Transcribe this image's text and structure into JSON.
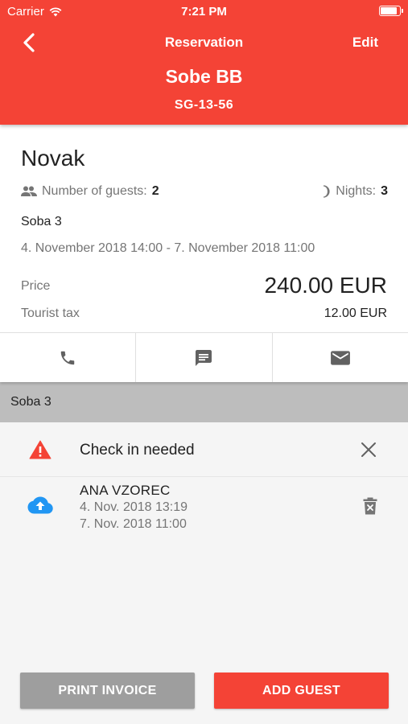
{
  "status_bar": {
    "carrier": "Carrier",
    "time": "7:21 PM",
    "battery_level": 0.92
  },
  "nav": {
    "title": "Reservation",
    "edit_label": "Edit",
    "back_icon": "chevron-left-icon"
  },
  "property": {
    "name": "Sobe BB",
    "code": "SG-13-56"
  },
  "reservation": {
    "guest_name": "Novak",
    "guests_label": "Number of guests:",
    "guests_value": "2",
    "nights_label": "Nights:",
    "nights_value": "3",
    "room": "Soba 3",
    "dates": "4. November 2018 14:00 - 7. November 2018 11:00",
    "price_label": "Price",
    "price_value": "240.00 EUR",
    "tax_label": "Tourist tax",
    "tax_value": "12.00 EUR"
  },
  "actions": [
    {
      "icon": "phone-icon"
    },
    {
      "icon": "message-icon"
    },
    {
      "icon": "mail-icon"
    }
  ],
  "section": {
    "title": "Soba 3"
  },
  "notice": {
    "text": "Check in needed",
    "icon": "warning-icon"
  },
  "guest": {
    "name": "ANA VZOREC",
    "line1": "4. Nov. 2018 13:19",
    "line2": "7. Nov. 2018 11:00",
    "icon": "cloud-upload-icon"
  },
  "buttons": {
    "print_invoice": "PRINT INVOICE",
    "add_guest": "ADD GUEST"
  },
  "colors": {
    "accent": "#f44336",
    "grey_button": "#9e9e9e",
    "section_bar": "#bdbdbd",
    "upload_blue": "#2196f3",
    "warning_red": "#f44336"
  }
}
